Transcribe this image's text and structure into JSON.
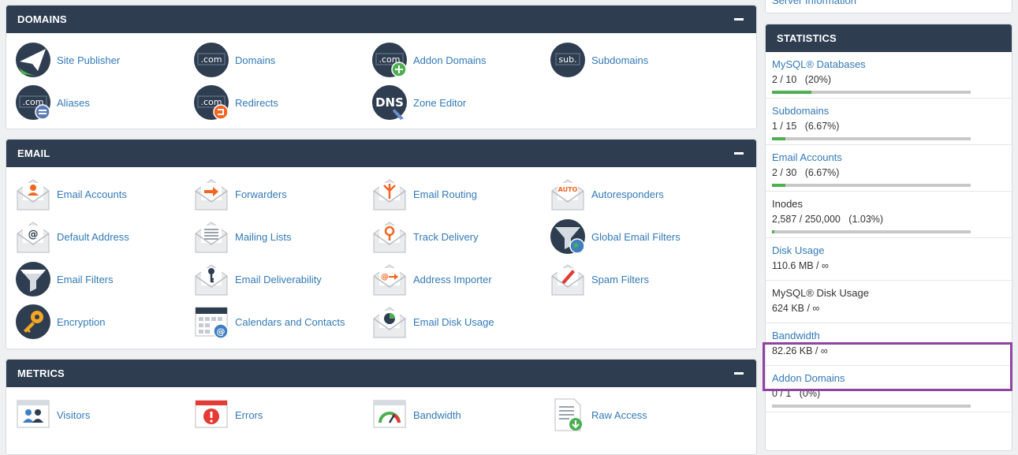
{
  "domains": {
    "title": "DOMAINS",
    "items": [
      {
        "label": "Site Publisher",
        "icon": "paper-plane-icon"
      },
      {
        "label": "Domains",
        "icon": "dotcom-icon"
      },
      {
        "label": "Addon Domains",
        "icon": "dotcom-plus-icon"
      },
      {
        "label": "Subdomains",
        "icon": "sub-icon"
      },
      {
        "label": "Aliases",
        "icon": "dotcom-equal-icon"
      },
      {
        "label": "Redirects",
        "icon": "dotcom-redirect-icon"
      },
      {
        "label": "Zone Editor",
        "icon": "dns-icon"
      }
    ]
  },
  "email": {
    "title": "EMAIL",
    "items": [
      {
        "label": "Email Accounts"
      },
      {
        "label": "Forwarders"
      },
      {
        "label": "Email Routing"
      },
      {
        "label": "Autoresponders",
        "badge": "AUTO"
      },
      {
        "label": "Default Address"
      },
      {
        "label": "Mailing Lists"
      },
      {
        "label": "Track Delivery"
      },
      {
        "label": "Global Email Filters"
      },
      {
        "label": "Email Filters"
      },
      {
        "label": "Email Deliverability"
      },
      {
        "label": "Address Importer"
      },
      {
        "label": "Spam Filters"
      },
      {
        "label": "Encryption"
      },
      {
        "label": "Calendars and Contacts"
      },
      {
        "label": "Email Disk Usage"
      }
    ]
  },
  "metrics": {
    "title": "METRICS",
    "items": [
      {
        "label": "Visitors"
      },
      {
        "label": "Errors"
      },
      {
        "label": "Bandwidth"
      },
      {
        "label": "Raw Access"
      }
    ]
  },
  "top_stub": {
    "label": "Server Information"
  },
  "statistics": {
    "title": "STATISTICS",
    "rows": [
      {
        "title": "MySQL® Databases",
        "value": "2 / 10   (20%)",
        "progress": 0.2,
        "link": true
      },
      {
        "title": "Subdomains",
        "value": "1 / 15   (6.67%)",
        "progress": 0.0667,
        "link": true
      },
      {
        "title": "Email Accounts",
        "value": "2 / 30   (6.67%)",
        "progress": 0.0667,
        "link": true
      },
      {
        "title": "Inodes",
        "value": "2,587 / 250,000   (1.03%)",
        "progress": 0.0103,
        "link": false
      },
      {
        "title": "Disk Usage",
        "value": "110.6 MB / ∞",
        "link": true
      },
      {
        "title": "MySQL® Disk Usage",
        "value": "624 KB / ∞",
        "link": false
      },
      {
        "title": "Bandwidth",
        "value": "82.26 KB / ∞",
        "link": true,
        "highlighted": true
      },
      {
        "title": "Addon Domains",
        "value": "0 / 1   (0%)",
        "progress": 0,
        "link": true
      }
    ]
  },
  "colors": {
    "header": "#2e3d50",
    "link": "#337ab7",
    "progress": "#4caf50",
    "highlight": "#8e44a0"
  }
}
